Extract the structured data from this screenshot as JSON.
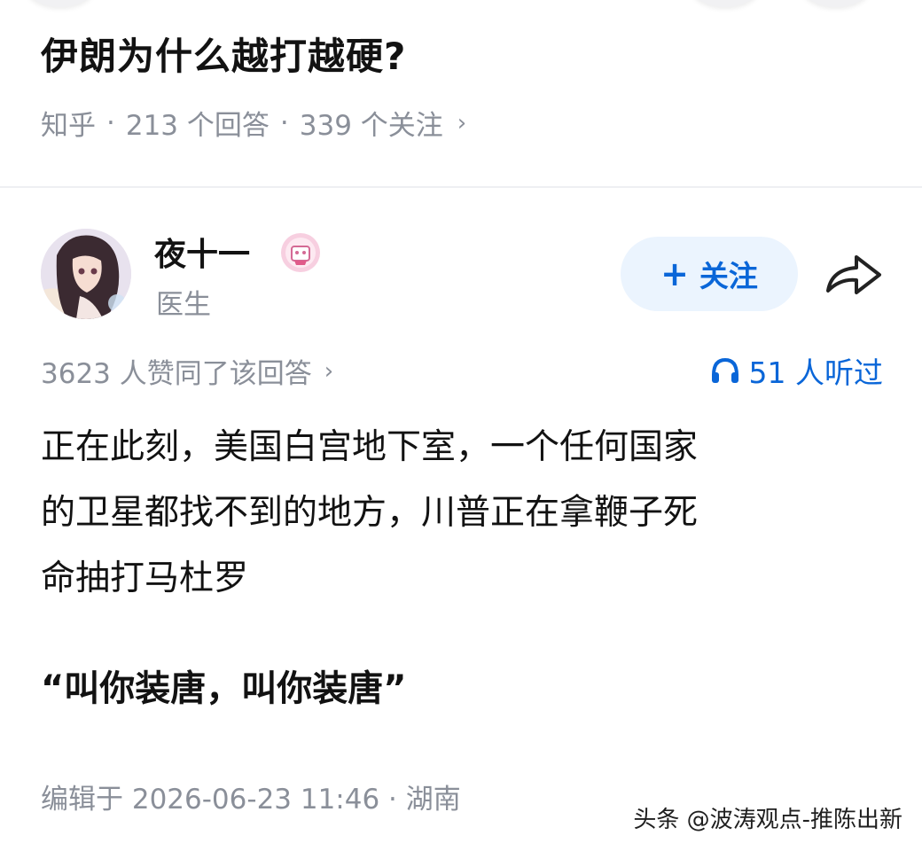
{
  "question": {
    "title": "伊朗为什么越打越硬?",
    "source": "知乎",
    "answers": "213 个回答",
    "followers": "339 个关注",
    "chevron": "›"
  },
  "author": {
    "name": "夜十一",
    "title": "医生",
    "follow_plus": "+",
    "follow_label": "关注"
  },
  "answer": {
    "votes": "3623 人赞同了该回答",
    "votes_chevron": "›",
    "listeners": "51 人听过",
    "line1": "正在此刻，美国白宫地下室，一个任何国家",
    "line2": "的卫星都找不到的地方，川普正在拿鞭子死",
    "line3": "命抽打马杜罗",
    "quote": "“叫你装唐，叫你装唐”",
    "edited": "编辑于 2026-06-23 11:46 · 湖南"
  },
  "watermark": "头条 @波涛观点-推陈出新",
  "colors": {
    "accent": "#0a66d8",
    "follow_bg": "#ebf4fe",
    "meta_gray": "#8a8f99"
  },
  "icons": [
    "avatar",
    "badge-icon",
    "share-icon",
    "headphones-icon"
  ]
}
